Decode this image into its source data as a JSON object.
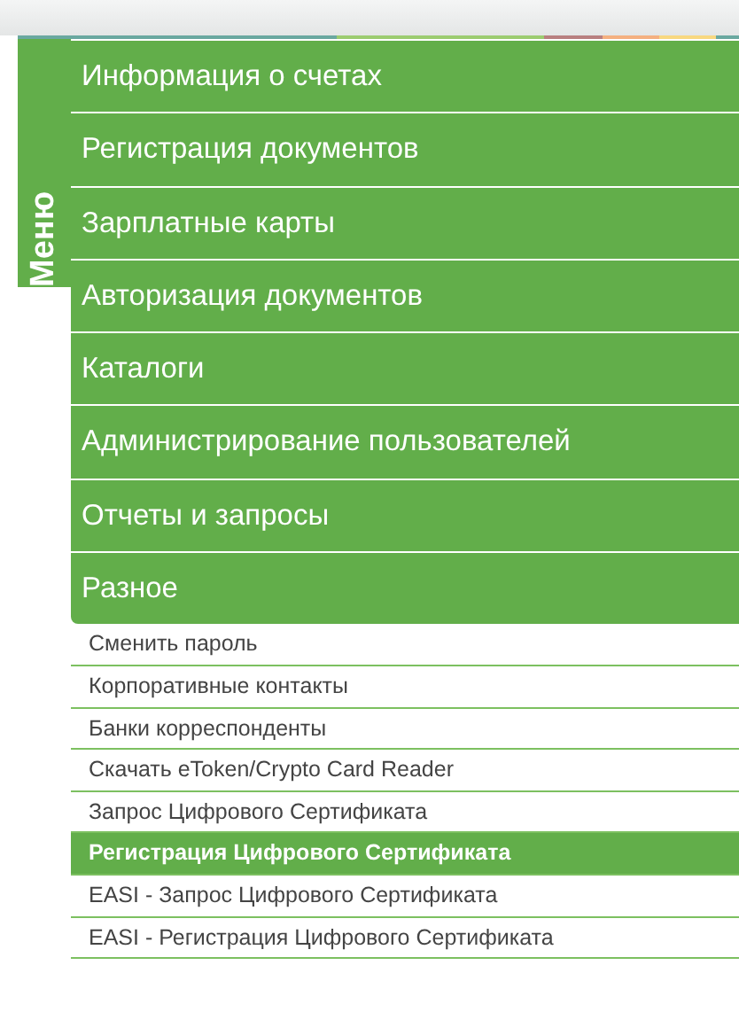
{
  "menu": {
    "title": "Меню",
    "items": [
      {
        "label": "Информация о счетах",
        "expanded": false
      },
      {
        "label": "Регистрация документов",
        "expanded": false
      },
      {
        "label": "Зарплатные карты",
        "expanded": false
      },
      {
        "label": "Авторизация документов",
        "expanded": false
      },
      {
        "label": "Каталоги",
        "expanded": false
      },
      {
        "label": "Администрирование пользователей",
        "expanded": false
      },
      {
        "label": "Отчеты и запросы",
        "expanded": false
      },
      {
        "label": "Разное",
        "expanded": true,
        "children": [
          {
            "label": "Сменить пароль",
            "selected": false
          },
          {
            "label": "Корпоративные контакты",
            "selected": false
          },
          {
            "label": "Банки корреспонденты",
            "selected": false
          },
          {
            "label": "Скачать eToken/Crypto Card Reader",
            "selected": false
          },
          {
            "label": "Запрос Цифрового Сертификата",
            "selected": false
          },
          {
            "label": "Регистрация Цифрового Сертификата",
            "selected": true
          },
          {
            "label": "EASI - Запрос Цифрового Сертификата",
            "selected": false
          },
          {
            "label": "EASI - Регистрация Цифрового Сертификата",
            "selected": false
          }
        ]
      }
    ]
  }
}
